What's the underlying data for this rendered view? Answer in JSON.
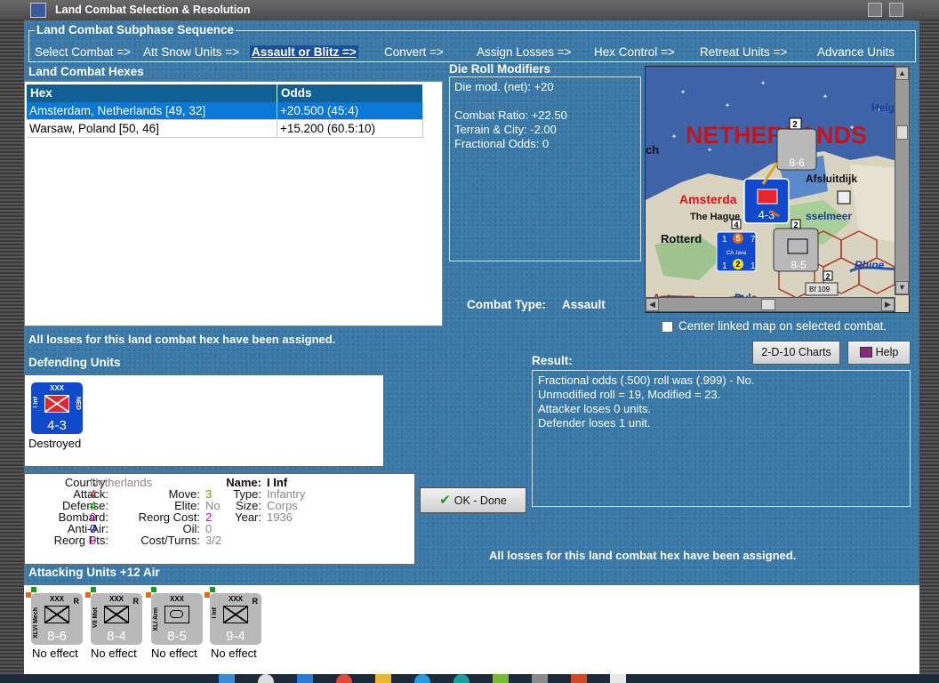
{
  "window": {
    "title": "Land Combat Selection & Resolution"
  },
  "subphase": {
    "legend": "Land Combat Subphase Sequence",
    "steps": [
      "Select Combat =>",
      "Att Snow Units =>",
      "Assault or Blitz =>",
      "Convert =>",
      "Assign Losses =>",
      "Hex Control =>",
      "Retreat Units =>",
      "Advance Units"
    ]
  },
  "hexes": {
    "label": "Land Combat Hexes",
    "col_hex": "Hex",
    "col_odds": "Odds",
    "rows": [
      {
        "hex": "Amsterdam, Netherlands [49, 32]",
        "odds": "+20.500 (45:4)"
      },
      {
        "hex": "Warsaw, Poland [50, 46]",
        "odds": "+15.200 (60.5:10)"
      }
    ]
  },
  "die": {
    "label": "Die Roll Modifiers",
    "lines": [
      "Die mod. (net): +20",
      "",
      "Combat Ratio: +22.50",
      "Terrain & City: -2.00",
      "Fractional Odds: 0"
    ]
  },
  "map": {
    "country": "NETHERLANDS",
    "places": [
      "Helg",
      "Amsterda",
      "The Hague",
      "Rotterd",
      "Afsluitdijk",
      "sselmeer",
      "Rhine",
      "ch",
      "Antwerp",
      "Dyle"
    ],
    "counter_values": [
      "2",
      "8-6",
      "4-3",
      "8-5",
      "4",
      "2",
      "2",
      "2",
      "5",
      "7",
      "1",
      "1",
      "1",
      "CA Java",
      "NED",
      "Bf 109",
      "XXX",
      "XXX",
      "xxx",
      "I Inf",
      "NED",
      "XLI Arm",
      "5"
    ]
  },
  "combat_type": {
    "label": "Combat Type:",
    "value": "Assault"
  },
  "center_map_label": "Center linked map on selected combat.",
  "buttons": {
    "charts": "2-D-10 Charts",
    "help": "Help",
    "ok": "OK - Done"
  },
  "status_losses_left": "All losses for this land combat hex have been assigned.",
  "status_losses_right": "All losses for this land combat hex have been assigned.",
  "defending": {
    "label": "Defending Units",
    "units": [
      {
        "xxx": "XXX",
        "name": "I Inf",
        "nation": "NED",
        "strength": "4-3",
        "effect": "Destroyed"
      }
    ]
  },
  "result": {
    "label": "Result:",
    "lines": [
      "Fractional odds (.500) roll was (.999)  - No.",
      "Unmodified roll = 19, Modified = 23.",
      "Attacker loses 0 units.",
      "Defender loses 1 unit."
    ]
  },
  "unit_info": {
    "country_k": "Country:",
    "country_v": "Netherlands",
    "attack_k": "Attack:",
    "attack_v": "4",
    "defense_k": "Defense:",
    "defense_v": "4",
    "bombard_k": "Bombard:",
    "bombard_v": "0",
    "antiair_k": "Anti-Air:",
    "antiair_v": "0",
    "reorgpts_k": "Reorg Pts:",
    "reorgpts_v": "0",
    "move_k": "Move:",
    "move_v": "3",
    "elite_k": "Elite:",
    "elite_v": "No",
    "reorgcost_k": "Reorg Cost:",
    "reorgcost_v": "2",
    "oil_k": "Oil:",
    "oil_v": "0",
    "costturns_k": "Cost/Turns:",
    "costturns_v": "3/2",
    "name_k": "Name:",
    "name_v": "I Inf",
    "type_k": "Type:",
    "type_v": "Infantry",
    "size_k": "Size:",
    "size_v": "Corps",
    "year_k": "Year:",
    "year_v": "1936"
  },
  "attacking": {
    "label": "Attacking Units +12 Air",
    "units": [
      {
        "xxx": "XXX",
        "name": "XLVI Mech",
        "r": "R",
        "strength": "8-6",
        "effect": "No effect"
      },
      {
        "xxx": "XXX",
        "name": "VII Mot",
        "r": "R",
        "strength": "8-4",
        "effect": "No effect"
      },
      {
        "xxx": "XXX",
        "name": "XLI Arm",
        "r": "R",
        "strength": "8-5",
        "effect": "No effect"
      },
      {
        "xxx": "XXX",
        "name": "I Inf",
        "r": "R",
        "strength": "9-4",
        "effect": "No effect"
      }
    ]
  },
  "colors": {
    "panel_blue": "#3a78a8",
    "header_blue": "#0f5f95",
    "selection_blue": "#0a78d4",
    "attack_red": "#e00000",
    "defense_green": "#009a00",
    "bombard_magenta": "#c000c0",
    "antiair_blue": "#0000cc",
    "move_olive": "#8a8a00",
    "grey_text": "#888888",
    "ned_blue": "#1049c9"
  }
}
